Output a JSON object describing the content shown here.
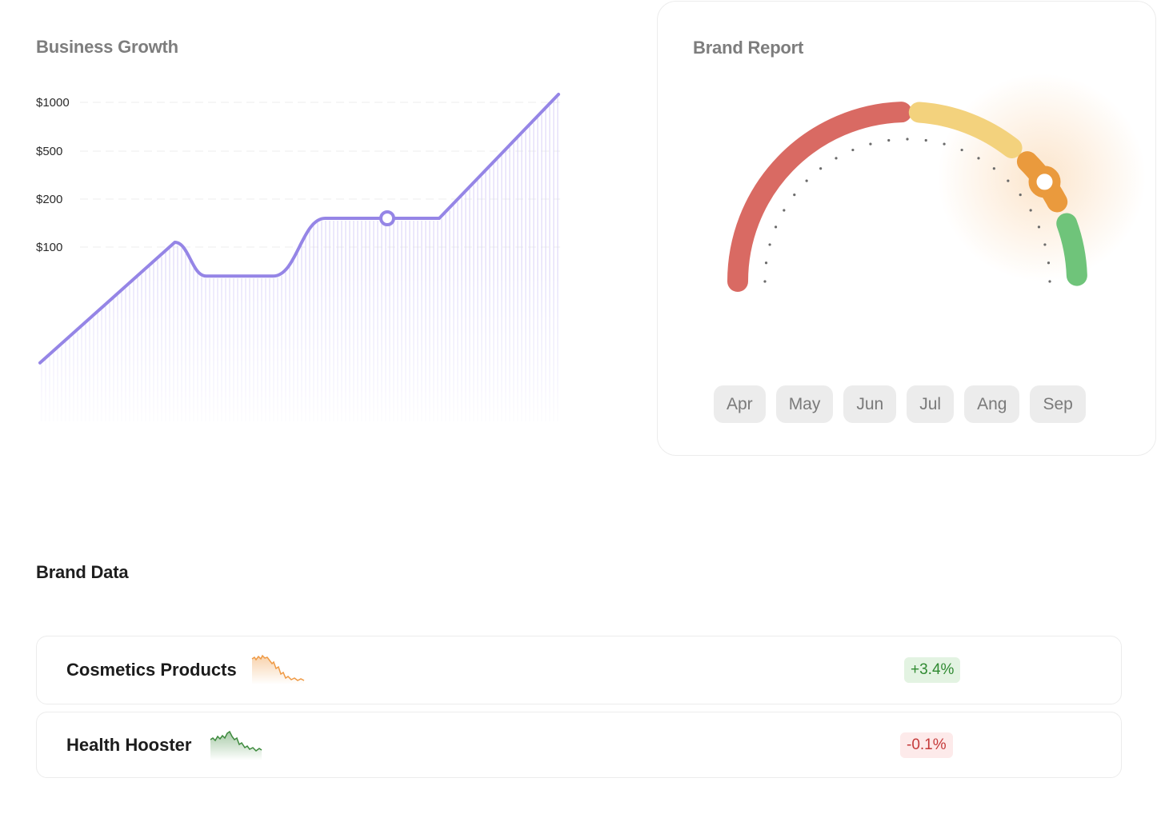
{
  "business_growth": {
    "title": "Business Growth"
  },
  "chart_data": {
    "type": "area",
    "title": "Business Growth",
    "y_scale": "categorical-nonlinear",
    "y_ticks": [
      "$1000",
      "$500",
      "$200",
      "$100"
    ],
    "y_tick_values": [
      1000,
      500,
      200,
      100
    ],
    "grid": true,
    "grid_style": "dashed",
    "series": [
      {
        "color": "#9585e6",
        "points": [
          {
            "x": 0,
            "y": 20
          },
          {
            "x": 0.26,
            "y": 110
          },
          {
            "x": 0.32,
            "y": 80
          },
          {
            "x": 0.45,
            "y": 80
          },
          {
            "x": 0.55,
            "y": 160
          },
          {
            "x": 0.71,
            "y": 160
          },
          {
            "x": 0.77,
            "y": 160
          },
          {
            "x": 1,
            "y": 1000
          }
        ]
      }
    ],
    "highlight_point_index": 5,
    "tooltip": null
  },
  "brand_report": {
    "title": "Brand Report",
    "gauge_segments": [
      {
        "color": "#d96a63",
        "label": "red"
      },
      {
        "color": "#f3d27d",
        "label": "yellow"
      },
      {
        "color": "#ea9a3d",
        "label": "orange"
      },
      {
        "color": "#6fc47a",
        "label": "green"
      }
    ],
    "indicator_color": "#ea9a3d",
    "months": [
      "Apr",
      "May",
      "Jun",
      "Jul",
      "Ang",
      "Sep"
    ]
  },
  "brand_data": {
    "title": "Brand Data",
    "rows": [
      {
        "name": "Cosmetics Products",
        "change": "+3.4%",
        "trend": "up",
        "spark_color": "#ef9a45"
      },
      {
        "name": "Health Hooster",
        "change": "-0.1%",
        "trend": "down",
        "spark_color": "#3d8a3d"
      }
    ]
  }
}
